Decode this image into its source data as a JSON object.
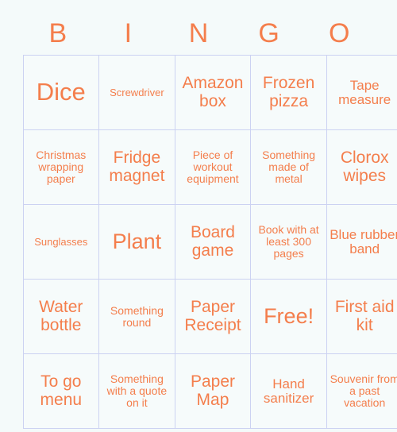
{
  "card": {
    "header_letters": [
      "B",
      "I",
      "N",
      "G",
      "O"
    ],
    "accent_color": "#f47e4c",
    "grid_line_color": "#ccd2f2",
    "cell_background": "#f6fbfb",
    "page_background": "#f4fafa",
    "rows": [
      [
        {
          "text": "Dice",
          "size": "xl"
        },
        {
          "text": "Screwdriver",
          "size": "xxs"
        },
        {
          "text": "Amazon box",
          "size": "md"
        },
        {
          "text": "Frozen pizza",
          "size": "md"
        },
        {
          "text": "Tape measure",
          "size": "sm"
        }
      ],
      [
        {
          "text": "Christmas wrapping paper",
          "size": "xs"
        },
        {
          "text": "Fridge magnet",
          "size": "md"
        },
        {
          "text": "Piece of workout equipment",
          "size": "xs"
        },
        {
          "text": "Something made of metal",
          "size": "xs"
        },
        {
          "text": "Clorox wipes",
          "size": "md"
        }
      ],
      [
        {
          "text": "Sunglasses",
          "size": "xxs"
        },
        {
          "text": "Plant",
          "size": "lg"
        },
        {
          "text": "Board game",
          "size": "md"
        },
        {
          "text": "Book with at least 300 pages",
          "size": "xs"
        },
        {
          "text": "Blue rubber band",
          "size": "sm"
        }
      ],
      [
        {
          "text": "Water bottle",
          "size": "md"
        },
        {
          "text": "Something round",
          "size": "xs"
        },
        {
          "text": "Paper Receipt",
          "size": "md"
        },
        {
          "text": "Free!",
          "size": "lg"
        },
        {
          "text": "First aid kit",
          "size": "md"
        }
      ],
      [
        {
          "text": "To go menu",
          "size": "md"
        },
        {
          "text": "Something with a quote on it",
          "size": "xs"
        },
        {
          "text": "Paper Map",
          "size": "md"
        },
        {
          "text": "Hand sanitizer",
          "size": "sm"
        },
        {
          "text": "Souvenir from a past vacation",
          "size": "xs"
        }
      ]
    ]
  }
}
